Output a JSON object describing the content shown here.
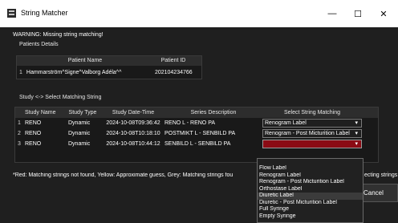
{
  "window": {
    "title": "String Matcher",
    "controls": {
      "minimize": "—",
      "maximize": "☐",
      "close": "✕"
    }
  },
  "warning": "WARNING: Missing string matching!",
  "patients": {
    "title": "Patients Details",
    "headers": {
      "name": "Patient Name",
      "id": "Patient ID"
    },
    "rows": [
      {
        "num": "1",
        "name": "Hammarström^Signe^Valborg Adéla^^",
        "id": "202104234766"
      }
    ]
  },
  "study": {
    "title": "Study <-> Select Matching String",
    "headers": {
      "name": "Study Name",
      "type": "Study Type",
      "date": "Study Date-Time",
      "desc": "Series Description",
      "match": "Select String Matching"
    },
    "rows": [
      {
        "num": "1",
        "name": "RENO",
        "type": "Dynamic",
        "date": "2024-10-08T09:36:42",
        "desc": "RENO L - RENO PA",
        "match": "Renogram Label"
      },
      {
        "num": "2",
        "name": "RENO",
        "type": "Dynamic",
        "date": "2024-10-08T10:18:10",
        "desc": "POSTMIKT L - SENBILD PA",
        "match": "Renogram - Post Micturition Label"
      },
      {
        "num": "3",
        "name": "RENO",
        "type": "Dynamic",
        "date": "2024-10-08T10:44:12",
        "desc": "SENBILD L - SENBILD PA",
        "match": ""
      }
    ]
  },
  "dropdown": {
    "options": [
      "Flow Label",
      "Renogram Label",
      "Renogram - Post Micturition Label",
      "Orthostase Label",
      "Diuretic Label",
      "Diuretic - Post Micturition Label",
      "Full Syringe",
      "Empty Syringe"
    ],
    "highlighted": "Diuretic Label"
  },
  "legend": {
    "text": "*Red: Matching strings not found, Yellow: Approximate guess, Grey: Matching strings fou",
    "tail": "ecting strings"
  },
  "cancel_label": "Cancel",
  "colors": {
    "mismatch_red": "#8b0b14",
    "background": "#1f1f1f"
  }
}
